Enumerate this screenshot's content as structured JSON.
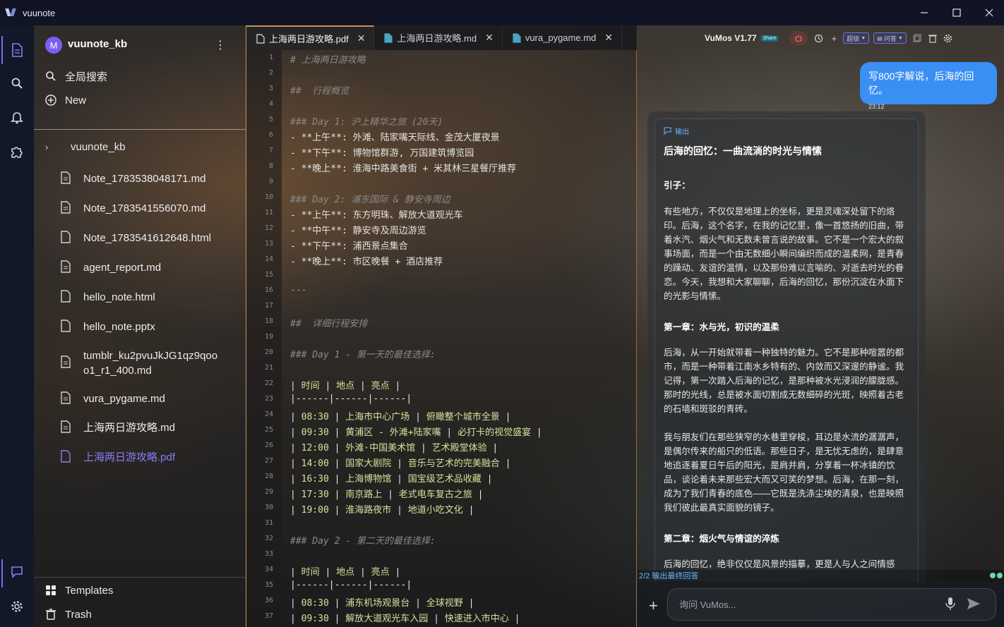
{
  "app": {
    "title": "vuunote"
  },
  "sidebar": {
    "workspace_initial": "M",
    "workspace_name": "vuunote_kb",
    "search_label": "全局搜索",
    "new_label": "New",
    "tree_root": "vuunote_kb",
    "files": [
      "Note_1783538048171.md",
      "Note_1783541556070.md",
      "Note_1783541612648.html",
      "agent_report.md",
      "hello_note.html",
      "hello_note.pptx",
      "tumblr_ku2pvuJkJG1qz9qoo o1_r1_400.md",
      "vura_pygame.md",
      "上海两日游攻略.md",
      "上海两日游攻略.pdf"
    ],
    "templates_label": "Templates",
    "trash_label": "Trash"
  },
  "tabs": [
    {
      "label": "上海两日游攻略.pdf",
      "active": true
    },
    {
      "label": "上海两日游攻略.md",
      "active": false
    },
    {
      "label": "vura_pygame.md",
      "active": false
    }
  ],
  "editor": {
    "lines": [
      "# 上海两日游攻略",
      "",
      "##  行程概览",
      "",
      "### Day 1: 沪上精华之旅 (20天)",
      "- **上午**: 外滩、陆家嘴天际线、金茂大厦夜景",
      "- **下午**: 博物馆群游, 万国建筑博览园",
      "- **晚上**: 淮海中路美食街 + 米其林三星餐厅推荐",
      "",
      "### Day 2: 浦东国际 & 静安寺周边",
      "- **上午**: 东方明珠、解放大道观光车",
      "- **中午**: 静安寺及周边游览",
      "- **下午**: 浦西景点集合",
      "- **晚上**: 市区晚餐 + 酒店推荐",
      "",
      "---",
      "",
      "##  详细行程安排",
      "",
      "### Day 1 - 第一天的最佳选择:",
      "",
      "| 时间 | 地点 | 亮点 |",
      "|------|------|------|",
      "| 08:30 | 上海市中心广场 | 俯瞰整个城市全景 |",
      "| 09:30 | 黄浦区 - 外滩+陆家嘴 | 必打卡的视觉盛宴 |",
      "| 12:00 | 外滩·中国美术馆 | 艺术殿堂体验 |",
      "| 14:00 | 国家大剧院 | 音乐与艺术的完美融合 |",
      "| 16:30 | 上海博物馆 | 国宝级艺术品收藏 |",
      "| 17:30 | 南京路上 | 老式电车复古之旅 |",
      "| 19:00 | 淮海路夜市 | 地道小吃文化 |",
      "",
      "### Day 2 - 第二天的最佳选择:",
      "",
      "| 时间 | 地点 | 亮点 |",
      "|------|------|------|",
      "| 08:30 | 浦东机场观景台 | 全球视野 |",
      "| 09:30 | 解放大道观光车入园 | 快速进入市中心 |"
    ]
  },
  "chat": {
    "title": "VuMos V1.77",
    "share_badge": "Share",
    "mode_chip": "超级",
    "qa_chip": "问答",
    "user_message": "写800字解说，后海的回忆。",
    "user_time": "23:12",
    "output_label": "输出",
    "response_title": "后海的回忆：一曲流淌的时光与情愫",
    "response_blocks": [
      {
        "type": "heading",
        "text": "引子："
      },
      {
        "type": "para",
        "text": "有些地方，不仅仅是地理上的坐标，更是灵魂深处留下的烙印。后海，这个名字，在我的记忆里，像一首悠扬的旧曲，带着水汽、烟火气和无数未曾言说的故事。它不是一个宏大的叙事场面，而是一个由无数细小瞬间编织而成的温柔网，是青春的躁动、友谊的温情，以及那份难以言喻的、对逝去时光的眷恋。今天，我想和大家聊聊，后海的回忆，那份沉淀在水面下的光影与情愫。"
      },
      {
        "type": "heading",
        "text": "第一章：水与光，初识的温柔"
      },
      {
        "type": "para",
        "text": "后海，从一开始就带着一种独特的魅力。它不是那种喧嚣的都市，而是一种带着江南水乡特有的、内敛而又深邃的静谧。我记得，第一次踏入后海的记忆，是那种被水光浸润的朦胧感。那时的光线，总是被水面切割成无数细碎的光斑，映照着古老的石墙和斑驳的青砖。"
      },
      {
        "type": "para",
        "text": "我与朋友们在那些狭窄的水巷里穿梭，耳边是水流的潺潺声，是偶尔传来的船只的低语。那些日子，是无忧无虑的，是肆意地追逐着夏日午后的阳光，是肩并肩，分享着一杯冰镇的饮品，谈论着未来那些宏大而又可笑的梦想。后海，在那一刻，成为了我们青春的底色——它既是洗涤尘埃的清泉，也是映照我们彼此最真实面貌的镜子。"
      },
      {
        "type": "heading",
        "text": "第二章：烟火气与情谊的淬炼"
      },
      {
        "type": "para",
        "text": "后海的回忆，绝非仅仅是风景的描摹，更是人与人之间情感"
      }
    ],
    "status_text": "2/2 输出最终回答",
    "input_placeholder": "询问 VuMos..."
  }
}
